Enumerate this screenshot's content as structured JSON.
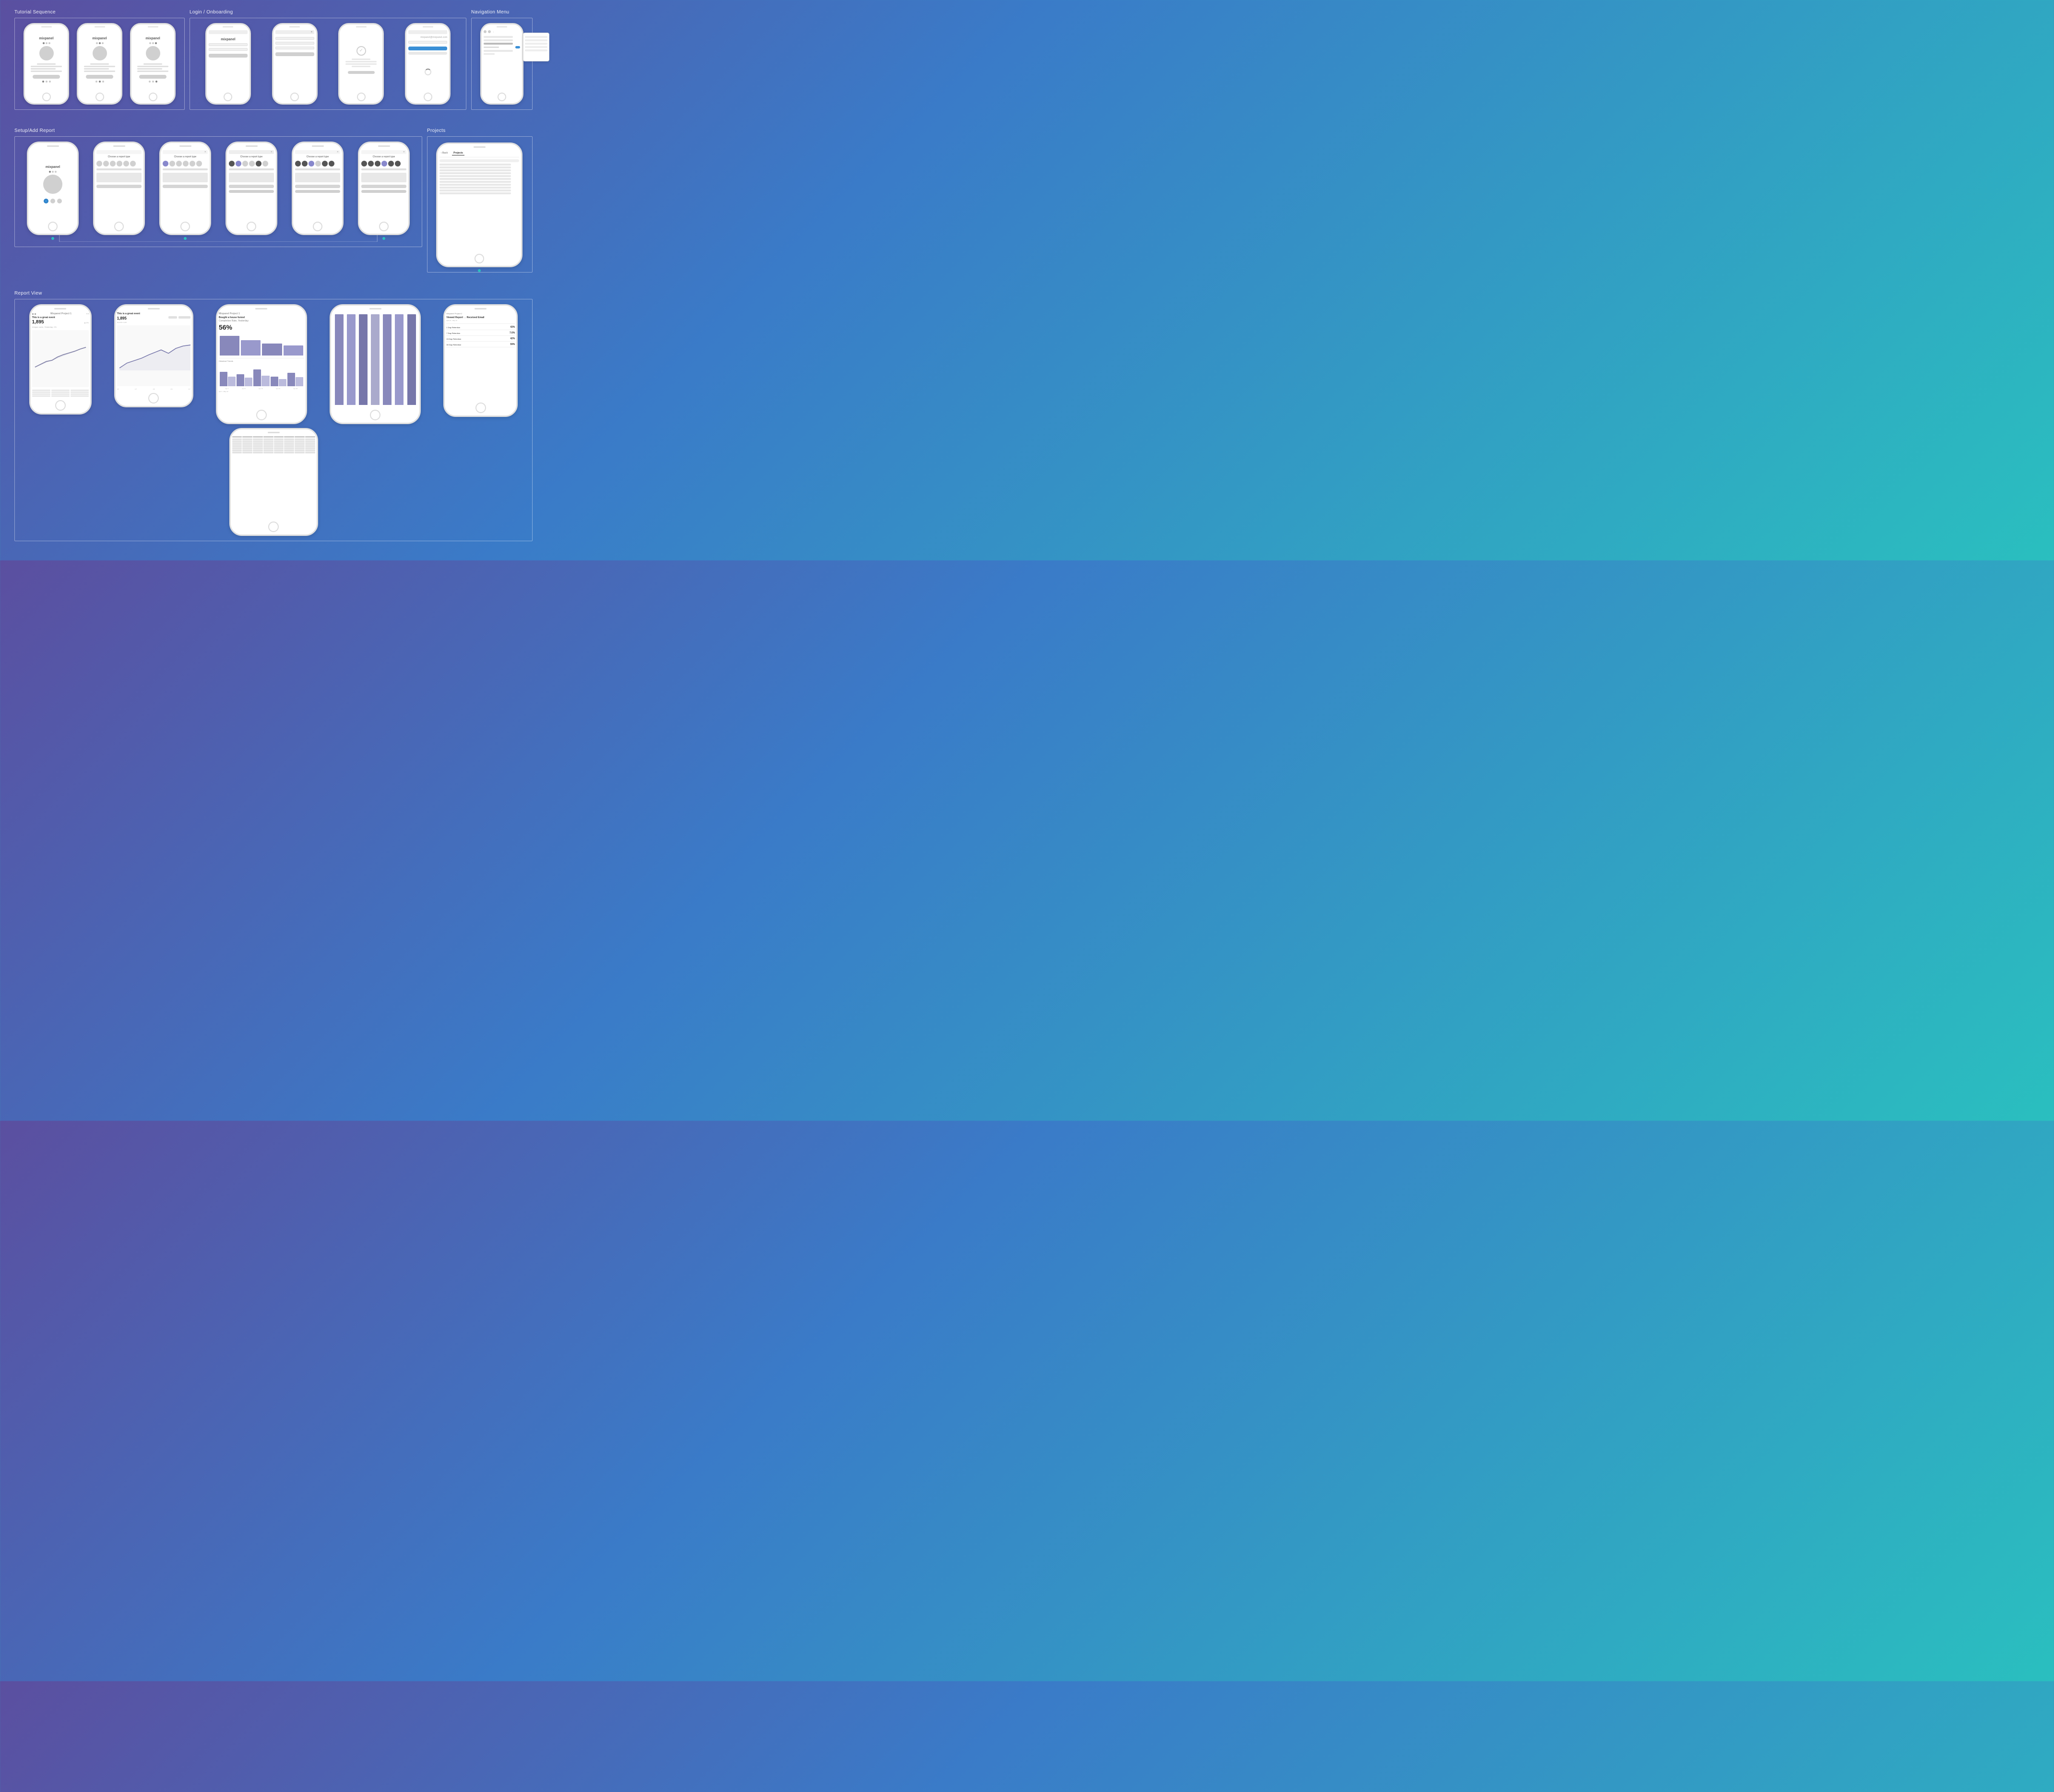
{
  "sections": {
    "tutorial": {
      "label": "Tutorial Sequence",
      "phones": [
        {
          "id": "t1",
          "type": "mixpanel_splash",
          "dots": [
            true,
            false,
            false
          ]
        },
        {
          "id": "t2",
          "type": "mixpanel_splash",
          "dots": [
            false,
            true,
            false
          ]
        },
        {
          "id": "t3",
          "type": "mixpanel_splash",
          "dots": [
            false,
            false,
            true
          ]
        }
      ]
    },
    "login": {
      "label": "Login / Onboarding",
      "phones": [
        {
          "id": "l1",
          "type": "login_form"
        },
        {
          "id": "l2",
          "type": "login_form2"
        },
        {
          "id": "l3",
          "type": "error_screen"
        },
        {
          "id": "l4",
          "type": "mixpanel_login_final"
        }
      ]
    },
    "nav": {
      "label": "Navigation Menu",
      "phones": [
        {
          "id": "n1",
          "type": "nav_menu"
        }
      ]
    },
    "setup": {
      "label": "Setup/Add Report",
      "phones": [
        {
          "id": "s1",
          "type": "mixpanel_splash_small"
        },
        {
          "id": "s2",
          "type": "choose_report"
        },
        {
          "id": "s3",
          "type": "choose_report_selected"
        },
        {
          "id": "s4",
          "type": "choose_report_dark"
        },
        {
          "id": "s5",
          "type": "choose_report_mid"
        },
        {
          "id": "s6",
          "type": "choose_report_final"
        }
      ]
    },
    "projects": {
      "label": "Projects",
      "phones": [
        {
          "id": "p1",
          "type": "projects_list"
        }
      ]
    },
    "report": {
      "label": "Report View",
      "phones": [
        {
          "id": "r1",
          "type": "line_chart_report"
        },
        {
          "id": "r2",
          "type": "line_chart_wide"
        },
        {
          "id": "r3",
          "type": "funnel_report"
        },
        {
          "id": "r4",
          "type": "bar_chart_report"
        },
        {
          "id": "r5",
          "type": "retention_report"
        },
        {
          "id": "r6",
          "type": "data_table_report"
        }
      ]
    }
  },
  "labels": {
    "mixpanel": "mixpanel",
    "nav_menu": "Navigation Menu",
    "setup_add": "Setup/Add Report",
    "tutorial": "Tutorial Sequence",
    "projects": "Projects",
    "report_view": "Report View",
    "choose": "choose",
    "back": "< Back",
    "projects_tab": "Projects",
    "funnel_label": "Bought a house funnel",
    "funnel_pct": "56%",
    "retention_title": "Viewed Report → Received Email",
    "retention_1day": "1 Day Retention",
    "retention_1day_val": "43%",
    "retention_7day": "7 Day Retention",
    "retention_7day_val": "7.6%",
    "retention_15day": "15 Day Retention",
    "retention_15day_val": "42%",
    "retention_30day": "30 Day Retention",
    "retention_30day_val": "59%",
    "report_title": "This is a great event",
    "report_value": "1,895",
    "report_sub": "Unique users, Yesterday, 1%"
  },
  "colors": {
    "background_start": "#5b4fa0",
    "background_end": "#2abfbf",
    "phone_border": "#e0e0e0",
    "accent_blue": "#3a8fd6",
    "accent_teal": "#2abfbf",
    "bar_blue": "#6699cc",
    "bar_gray": "#aaaaaa",
    "chart_line": "#666688"
  }
}
